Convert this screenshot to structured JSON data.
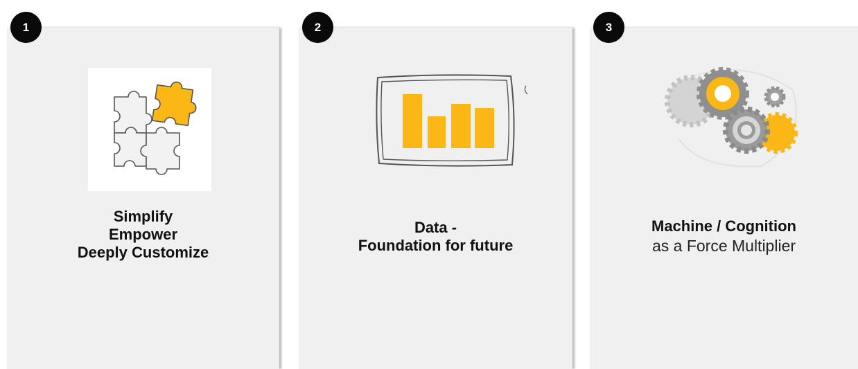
{
  "cards": [
    {
      "number": "1",
      "lines": [
        "Simplify",
        "Empower",
        "Deeply Customize"
      ],
      "icon": "puzzle-pieces-icon"
    },
    {
      "number": "2",
      "lines": [
        "Data -",
        "Foundation for future"
      ],
      "icon": "bar-chart-board-icon"
    },
    {
      "number": "3",
      "lines": [
        "Machine / Cognition",
        "as a Force Multiplier"
      ],
      "icon": "gears-icon"
    }
  ],
  "colors": {
    "accent": "#fbb715",
    "card": "#f0f0f0",
    "badge": "#0a0a0a",
    "outline": "#555555"
  }
}
